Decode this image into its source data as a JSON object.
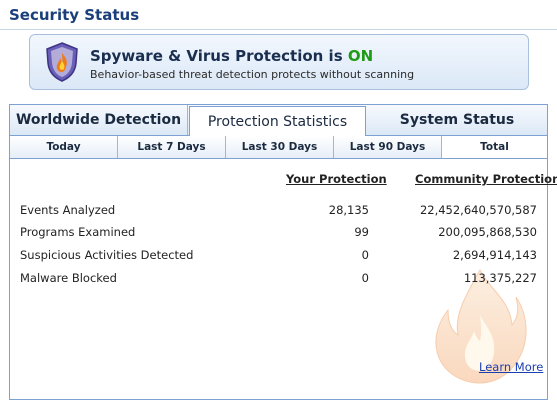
{
  "page": {
    "title": "Security Status"
  },
  "banner": {
    "heading_prefix": "Spyware & Virus Protection is ",
    "status": "ON",
    "subtitle": "Behavior-based threat detection protects without scanning",
    "status_color": "#1f9a16",
    "icon": "shield-flame-icon"
  },
  "tabs": [
    {
      "label": "Worldwide Detection",
      "active": false
    },
    {
      "label": "Protection Statistics",
      "active": true
    },
    {
      "label": "System Status",
      "active": false
    }
  ],
  "subtabs": [
    {
      "label": "Today",
      "active": false
    },
    {
      "label": "Last 7 Days",
      "active": false
    },
    {
      "label": "Last 30 Days",
      "active": false
    },
    {
      "label": "Last 90 Days",
      "active": false
    },
    {
      "label": "Total",
      "active": true
    }
  ],
  "stats": {
    "col_yours": "Your Protection",
    "col_community": "Community Protection",
    "rows": [
      {
        "label": "Events Analyzed",
        "yours": "28,135",
        "community": "22,452,640,570,587"
      },
      {
        "label": "Programs Examined",
        "yours": "99",
        "community": "200,095,868,530"
      },
      {
        "label": "Suspicious Activities Detected",
        "yours": "0",
        "community": "2,694,914,143"
      },
      {
        "label": "Malware Blocked",
        "yours": "0",
        "community": "113,375,227"
      }
    ]
  },
  "learn_more": "Learn More",
  "colors": {
    "title": "#1a3f7a",
    "border": "#7da2d1",
    "link": "#1a3fb0"
  }
}
